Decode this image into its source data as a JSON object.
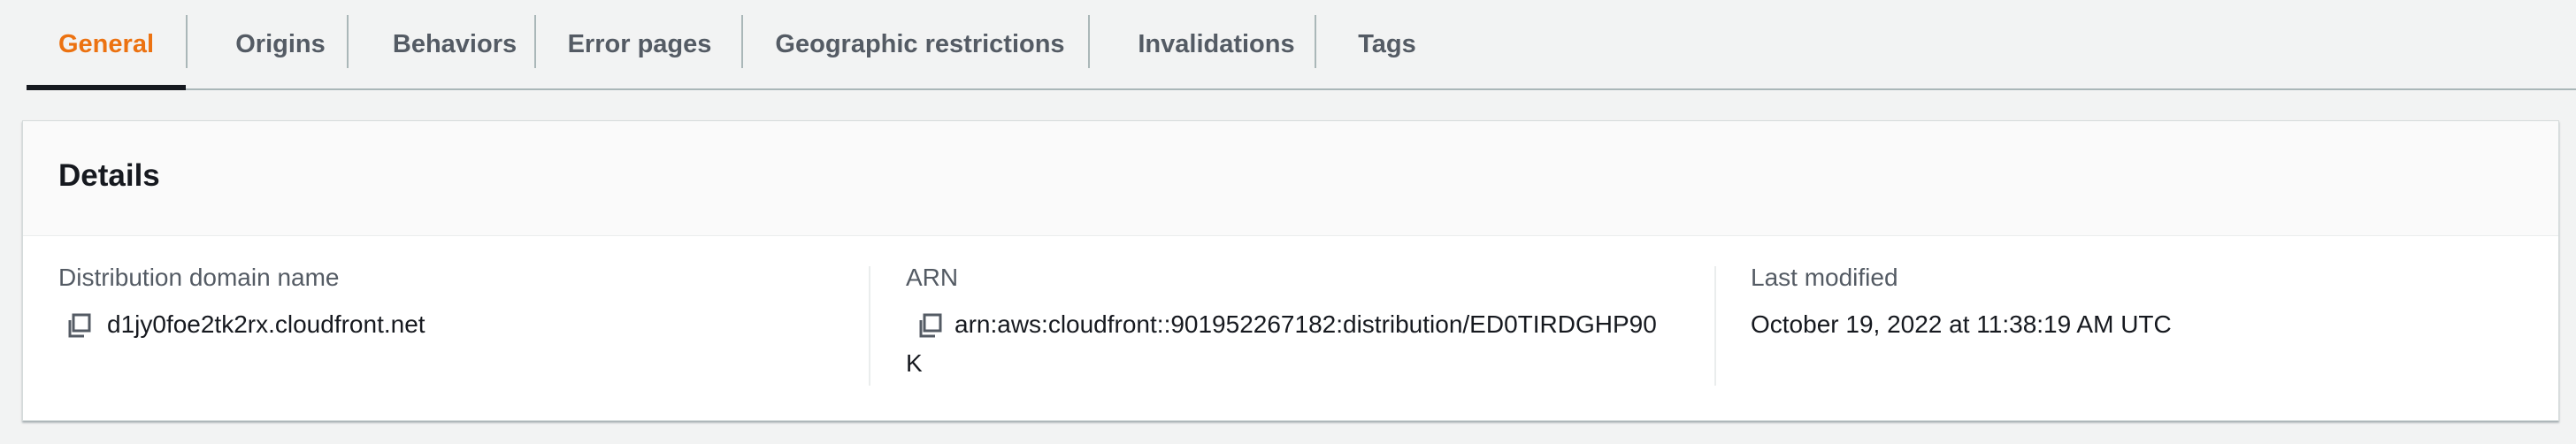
{
  "tabs": [
    {
      "label": "General",
      "active": true
    },
    {
      "label": "Origins",
      "active": false
    },
    {
      "label": "Behaviors",
      "active": false
    },
    {
      "label": "Error pages",
      "active": false
    },
    {
      "label": "Geographic restrictions",
      "active": false
    },
    {
      "label": "Invalidations",
      "active": false
    },
    {
      "label": "Tags",
      "active": false
    }
  ],
  "details": {
    "title": "Details",
    "domain_name": {
      "label": "Distribution domain name",
      "value": "d1jy0foe2tk2rx.cloudfront.net",
      "icon": "copy-icon"
    },
    "arn": {
      "label": "ARN",
      "value_line1": "arn:aws:cloudfront::901952267182:distribution/ED0TIRDGHP90",
      "value_line2": "K",
      "icon": "copy-icon"
    },
    "last_modified": {
      "label": "Last modified",
      "value": "October 19, 2022 at 11:38:19 AM UTC"
    }
  },
  "colors": {
    "active_tab": "#ec7211",
    "tab_text": "#545b64",
    "page_bg": "#f2f3f3",
    "card_bg": "#ffffff",
    "header_bg": "#fafafa"
  }
}
